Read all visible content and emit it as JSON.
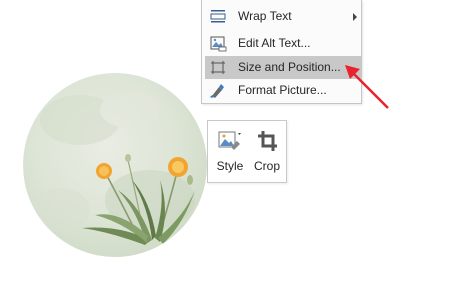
{
  "context_menu": {
    "items": [
      {
        "label": "Wrap Text",
        "icon": "wrap-text-icon",
        "has_submenu": true
      },
      {
        "label": "Edit Alt Text...",
        "icon": "alt-text-icon",
        "has_submenu": false
      },
      {
        "label": "Size and Position...",
        "icon": "size-position-icon",
        "has_submenu": false,
        "highlighted": true
      },
      {
        "label": "Format Picture...",
        "icon": "format-picture-icon",
        "has_submenu": false
      }
    ]
  },
  "mini_toolbar": {
    "style_label": "Style",
    "crop_label": "Crop"
  },
  "colors": {
    "highlight": "#c8c8c8",
    "annotation_arrow": "#e8232d",
    "picture_tint": "#dfe6d8",
    "flower": "#f2a431"
  }
}
